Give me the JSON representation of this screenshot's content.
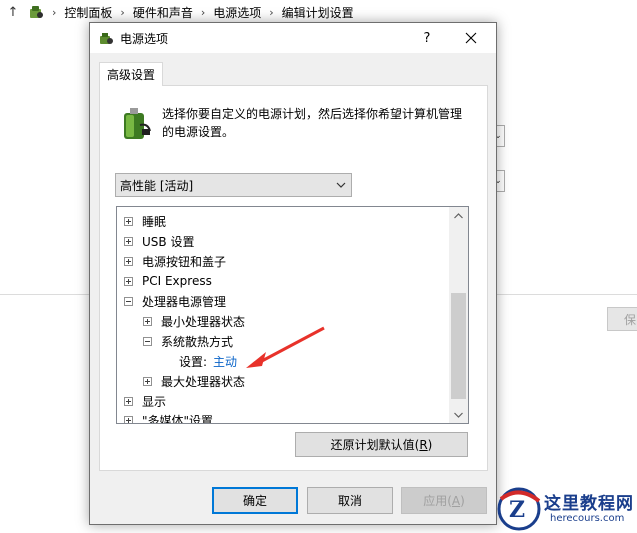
{
  "explorer": {
    "breadcrumb": [
      "控制面板",
      "硬件和声音",
      "电源选项",
      "编辑计划设置"
    ],
    "save_partial": "保"
  },
  "dialog": {
    "title": "电源选项",
    "help": "?",
    "tab": "高级设置",
    "description": "选择你要自定义的电源计划，然后选择你希望计算机管理的电源设置。",
    "plan_selected": "高性能 [活动]",
    "tree": [
      {
        "label": "睡眠",
        "toggle": "plus",
        "level": 0
      },
      {
        "label": "USB 设置",
        "toggle": "plus",
        "level": 0
      },
      {
        "label": "电源按钮和盖子",
        "toggle": "plus",
        "level": 0
      },
      {
        "label": "PCI Express",
        "toggle": "plus",
        "level": 0
      },
      {
        "label": "处理器电源管理",
        "toggle": "minus",
        "level": 0
      },
      {
        "label": "最小处理器状态",
        "toggle": "plus",
        "level": 1
      },
      {
        "label": "系统散热方式",
        "toggle": "minus",
        "level": 1
      },
      {
        "label": "设置:",
        "value": "主动",
        "toggle": "none",
        "level": 2
      },
      {
        "label": "最大处理器状态",
        "toggle": "plus",
        "level": 1
      },
      {
        "label": "显示",
        "toggle": "plus",
        "level": 0
      },
      {
        "label": "\"多媒体\"设置",
        "toggle": "plus",
        "level": 0
      }
    ],
    "restore_label": "还原计划默认值",
    "restore_key": "R",
    "ok_label": "确定",
    "cancel_label": "取消",
    "apply_label": "应用",
    "apply_key": "A"
  },
  "watermark": {
    "title": "这里教程网",
    "url": "herecours.com"
  },
  "colors": {
    "accent": "#0078d7",
    "link": "#0a64c8",
    "annotation": "#e8322a"
  },
  "icons": [
    "up-arrow-icon",
    "control-panel-icon",
    "power-plan-icon",
    "battery-plug-icon",
    "close-icon",
    "chevron-down-icon"
  ]
}
